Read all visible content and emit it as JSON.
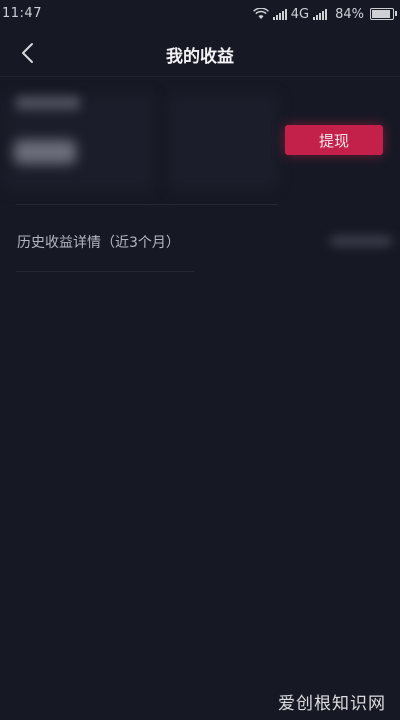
{
  "status_bar": {
    "time": "11:47",
    "network": "4G",
    "battery_percent": "84%",
    "battery_level": 0.84
  },
  "nav": {
    "title": "我的收益",
    "back_icon": "chevron-left-icon"
  },
  "balance": {
    "withdraw_label": "提现",
    "accent_color": "#c4214a"
  },
  "history": {
    "label": "历史收益详情（近3个月）"
  },
  "watermark": "爱创根知识网"
}
